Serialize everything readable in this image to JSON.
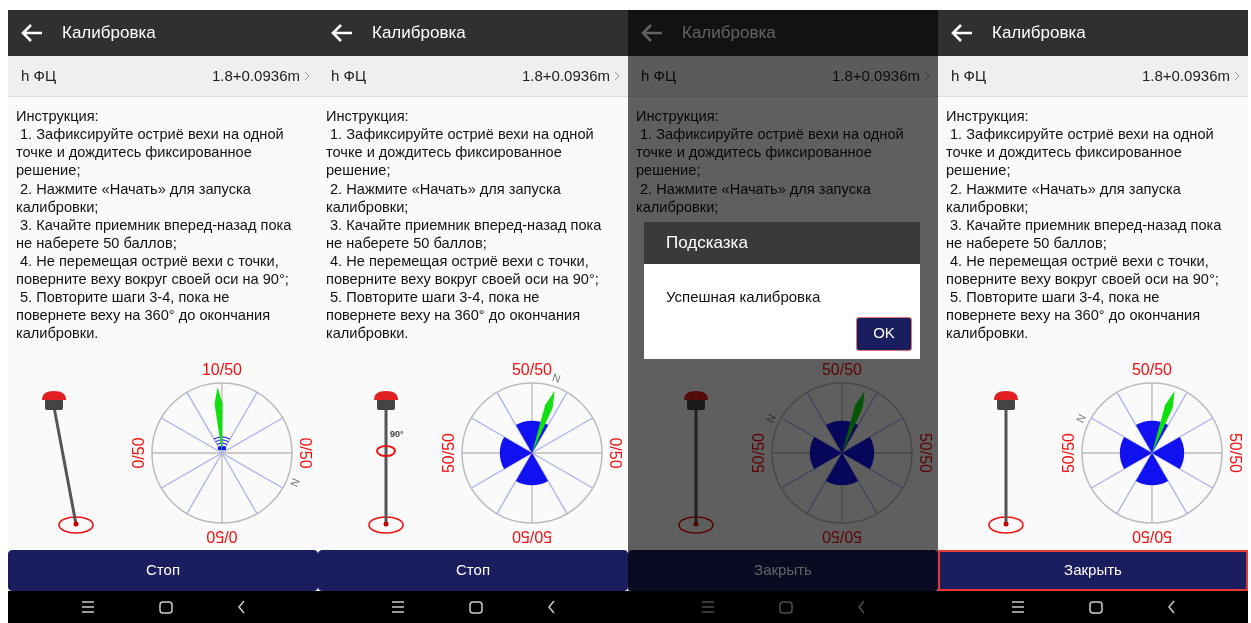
{
  "panels": [
    {
      "header": {
        "title": "Калибровка"
      },
      "antenna_row": {
        "label": "h ФЦ",
        "value": "1.8+0.0936m"
      },
      "instructions": {
        "title": "Инструкция:",
        "steps": [
          "1. Зафиксируйте остриё вехи на одной точке и дождитесь фиксированное решение;",
          "2. Нажмите «Начать» для запуска калибровки;",
          "3. Качайте приемник вперед-назад пока не наберете 50 баллов;",
          "4. Не перемещая остриё вехи с точки, поверните веху вокруг своей оси на 90°;",
          "5. Повторите шаги 3-4, пока не повернете веху на 360° до окончания калибровки."
        ]
      },
      "pole": {
        "kind": "tilted"
      },
      "compass": {
        "north": "N",
        "sectors": [
          {
            "label": "10/50",
            "kind": "partial"
          },
          {
            "label": "0/50",
            "kind": "empty"
          },
          {
            "label": "0/50",
            "kind": "empty"
          },
          {
            "label": "0/50",
            "kind": "empty"
          }
        ]
      },
      "button": {
        "label": "Стоп",
        "focused": false
      }
    },
    {
      "header": {
        "title": "Калибровка"
      },
      "antenna_row": {
        "label": "h ФЦ",
        "value": "1.8+0.0936m"
      },
      "instructions": {
        "title": "Инструкция:",
        "steps": [
          "1. Зафиксируйте остриё вехи на одной точке и дождитесь фиксированное решение;",
          "2. Нажмите «Начать» для запуска калибровки;",
          "3. Качайте приемник вперед-назад пока не наберете 50 баллов;",
          "4. Не перемещая остриё вехи с точки, поверните веху вокруг своей оси на 90°;",
          "5. Повторите шаги 3-4, пока не повернете веху на 360° до окончания калибровки."
        ]
      },
      "pole": {
        "kind": "rotating",
        "angle_label": "90°"
      },
      "compass": {
        "north": "N",
        "sectors": [
          {
            "label": "50/50",
            "kind": "full"
          },
          {
            "label": "0/50",
            "kind": "empty"
          },
          {
            "label": "50/50",
            "kind": "full"
          },
          {
            "label": "50/50",
            "kind": "full"
          }
        ]
      },
      "button": {
        "label": "Стоп",
        "focused": false
      }
    },
    {
      "header": {
        "title": "Калибровка"
      },
      "antenna_row": {
        "label": "h ФЦ",
        "value": "1.8+0.0936m"
      },
      "instructions": {
        "title": "Инструкция:",
        "steps": [
          "1. Зафиксируйте остриё вехи на одной точке и дождитесь фиксированное решение;",
          "2. Нажмите «Начать» для запуска калибровки;"
        ]
      },
      "pole": {
        "kind": "upright"
      },
      "compass": {
        "north": "N",
        "sectors": [
          {
            "label": "50/50",
            "kind": "full"
          },
          {
            "label": "50/50",
            "kind": "full"
          },
          {
            "label": "50/50",
            "kind": "full"
          },
          {
            "label": "50/50",
            "kind": "full"
          }
        ]
      },
      "button": {
        "label": "Закрыть",
        "focused": false
      },
      "dialog": {
        "title": "Подсказка",
        "message": "Успешная калибровка",
        "button": "OK"
      }
    },
    {
      "header": {
        "title": "Калибровка"
      },
      "antenna_row": {
        "label": "h ФЦ",
        "value": "1.8+0.0936m"
      },
      "instructions": {
        "title": "Инструкция:",
        "steps": [
          "1. Зафиксируйте остриё вехи на одной точке и дождитесь фиксированное решение;",
          "2. Нажмите «Начать» для запуска калибровки;",
          "3. Качайте приемник вперед-назад пока не наберете 50 баллов;",
          "4. Не перемещая остриё вехи с точки, поверните веху вокруг своей оси на 90°;",
          "5. Повторите шаги 3-4, пока не повернете веху на 360° до окончания калибровки."
        ]
      },
      "pole": {
        "kind": "upright"
      },
      "compass": {
        "north": "N",
        "sectors": [
          {
            "label": "50/50",
            "kind": "full"
          },
          {
            "label": "50/50",
            "kind": "full"
          },
          {
            "label": "50/50",
            "kind": "full"
          },
          {
            "label": "50/50",
            "kind": "full"
          }
        ]
      },
      "button": {
        "label": "Закрыть",
        "focused": true
      }
    }
  ]
}
